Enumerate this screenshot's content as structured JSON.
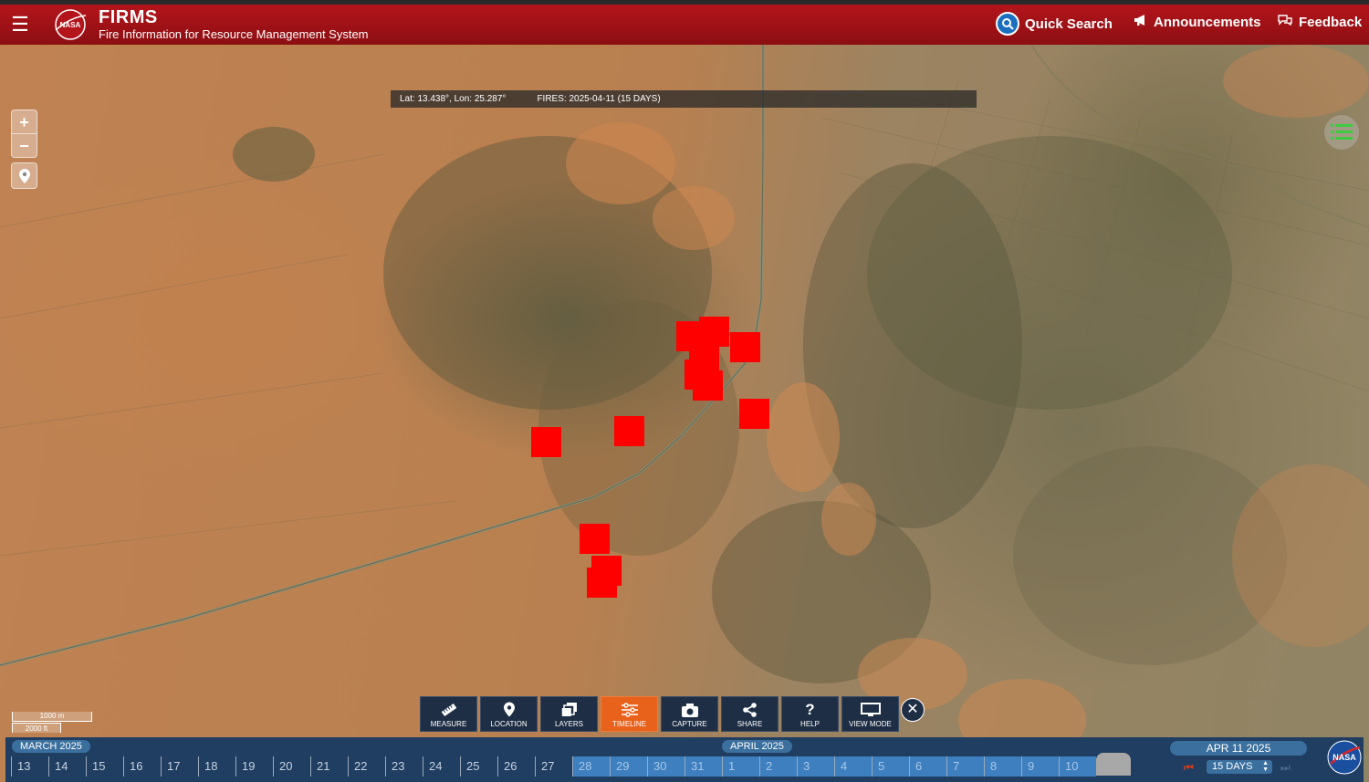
{
  "header": {
    "brand_title": "FIRMS",
    "brand_subtitle": "Fire Information for Resource Management System",
    "logo_text": "NASA",
    "quick_search": "Quick Search",
    "announcements": "Announcements",
    "feedback": "Feedback"
  },
  "map": {
    "coords": "Lat: 13.438°, Lon: 25.287°",
    "fires_info": "FIRES: 2025-04-11 (15 DAYS)",
    "zoom_in": "+",
    "zoom_out": "−",
    "scale_metric": "1000 m",
    "scale_imperial": "2000 ft",
    "fire_color": "#ff0000"
  },
  "toolbar": {
    "measure": "MEASURE",
    "location": "LOCATION",
    "layers": "LAYERS",
    "timeline": "TIMELINE",
    "capture": "CAPTURE",
    "share": "SHARE",
    "help": "HELP",
    "view_mode": "VIEW MODE",
    "close": "✕"
  },
  "timeline": {
    "month_march": "MARCH 2025",
    "month_april": "APRIL 2025",
    "days_march": [
      "13",
      "14",
      "15",
      "16",
      "17",
      "18",
      "19",
      "20",
      "21",
      "22",
      "23",
      "24",
      "25",
      "26",
      "27",
      "28",
      "29",
      "30",
      "31"
    ],
    "days_april": [
      "1",
      "2",
      "3",
      "4",
      "5",
      "6",
      "7",
      "8",
      "9",
      "10"
    ],
    "current_date": "APR 11 2025",
    "range": "15 DAYS",
    "logo_text": "NASA"
  }
}
